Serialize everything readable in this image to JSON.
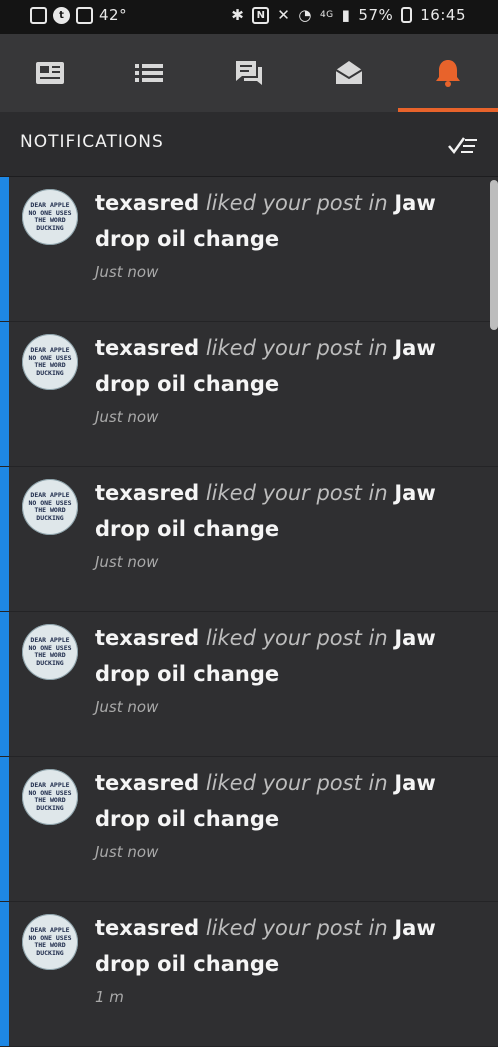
{
  "status_bar": {
    "temperature": "42°",
    "battery": "57%",
    "time": "16:45",
    "network": "4G"
  },
  "tabs": [
    {
      "name": "news-icon"
    },
    {
      "name": "list-icon"
    },
    {
      "name": "chat-icon"
    },
    {
      "name": "inbox-icon"
    },
    {
      "name": "bell-icon",
      "active": true
    }
  ],
  "header": {
    "title": "NOTIFICATIONS"
  },
  "avatar_text": "DEAR APPLE NO ONE USES THE WORD DUCKING",
  "notifications": [
    {
      "user": "texasred",
      "verb": "liked your post in",
      "topic": "Jaw drop oil change",
      "time": "Just now"
    },
    {
      "user": "texasred",
      "verb": "liked your post in",
      "topic": "Jaw drop oil change",
      "time": "Just now"
    },
    {
      "user": "texasred",
      "verb": "liked your post in",
      "topic": "Jaw drop oil change",
      "time": "Just now"
    },
    {
      "user": "texasred",
      "verb": "liked your post in",
      "topic": "Jaw drop oil change",
      "time": "Just now"
    },
    {
      "user": "texasred",
      "verb": "liked your post in",
      "topic": "Jaw drop oil change",
      "time": "Just now"
    },
    {
      "user": "texasred",
      "verb": "liked your post in",
      "topic": "Jaw drop oil change",
      "time": "1 m"
    }
  ],
  "colors": {
    "accent": "#e8632b",
    "unread": "#1e88e5"
  }
}
